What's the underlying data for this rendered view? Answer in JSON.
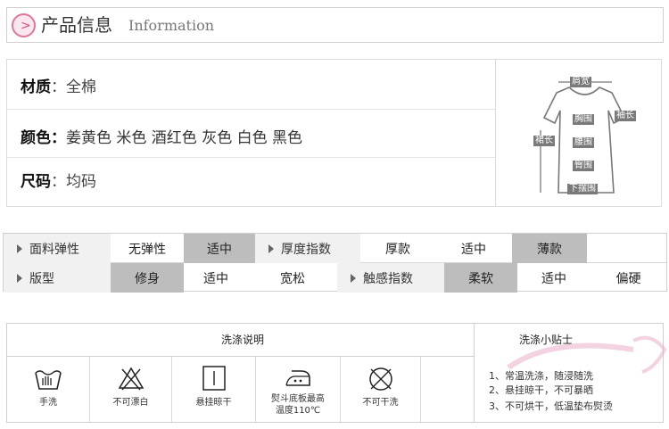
{
  "header": {
    "title": "产品信息",
    "subtitle": "Information",
    "icon": "chevron-right-icon"
  },
  "material": {
    "rows": [
      {
        "key": "材质",
        "colon": "：",
        "value": "全棉"
      },
      {
        "key": "颜色",
        "colon": "：",
        "value": "姜黄色 米色 酒红色 灰色 白色 黑色"
      },
      {
        "key": "尺码",
        "colon": "：",
        "value": "均码"
      }
    ],
    "diagram": {
      "icon": "dress-measurement-icon",
      "labels": {
        "shoulder": "肩宽",
        "sleeve": "袖长",
        "chest": "胸围",
        "length": "裙长",
        "waist": "腰围",
        "hip": "臀围",
        "hem": "下摆围"
      }
    }
  },
  "attributes": {
    "row1": [
      {
        "label": "面料弹性",
        "options": [
          "无弹性",
          "适中"
        ],
        "selected": "适中"
      },
      {
        "label": "厚度指数",
        "options": [
          "厚款",
          "适中",
          "薄款"
        ],
        "selected": "薄款"
      }
    ],
    "row2": [
      {
        "label": "版型",
        "options": [
          "修身",
          "适中",
          "宽松"
        ],
        "selected": "修身"
      },
      {
        "label": "触感指数",
        "options": [
          "柔软",
          "适中",
          "偏硬"
        ],
        "selected": "柔软"
      }
    ]
  },
  "care": {
    "title": "洗涤说明",
    "items": [
      {
        "icon": "hand-wash-icon",
        "label": "手洗"
      },
      {
        "icon": "no-bleach-icon",
        "label": "不可漂白"
      },
      {
        "icon": "line-dry-icon",
        "label": "悬挂晾干"
      },
      {
        "icon": "iron-medium-icon",
        "label": "熨斗底板最高",
        "label2": "温度110℃"
      },
      {
        "icon": "no-dry-clean-icon",
        "label": "不可干洗"
      }
    ],
    "tips_title": "洗涤小贴士",
    "tips": [
      "1、常温洗涤，随浸随洗",
      "2、悬挂晾干，不可暴晒",
      "3、不可烘干，低温垫布熨烫"
    ]
  },
  "colors": {
    "accent": "#d64b82",
    "selected_cell": "#bdbdbd",
    "label_cell": "#f1f1f1"
  }
}
